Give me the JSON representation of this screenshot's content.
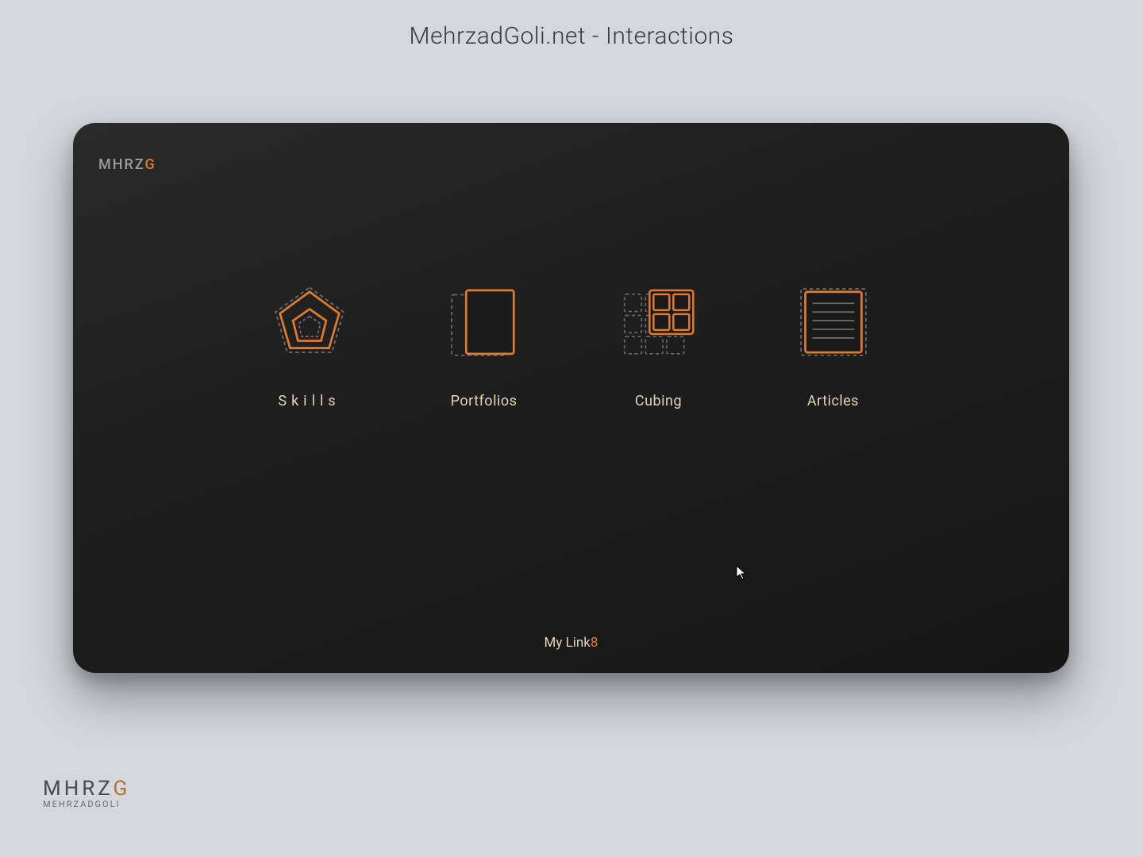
{
  "page": {
    "title": "MehrzadGoli.net - Interactions"
  },
  "logo": {
    "prefix": "MHRZ",
    "accent": "G"
  },
  "cards": [
    {
      "id": "skills",
      "label": "Skills",
      "icon": "pentagon-icon"
    },
    {
      "id": "portfolios",
      "label": "Portfolios",
      "icon": "stack-icon"
    },
    {
      "id": "cubing",
      "label": "Cubing",
      "icon": "grid-icon"
    },
    {
      "id": "articles",
      "label": "Articles",
      "icon": "document-icon"
    }
  ],
  "footer": {
    "link_prefix": "My Link",
    "link_accent": "8"
  },
  "brand": {
    "big_prefix": "MHRZ",
    "big_accent": "G",
    "small": "MEHRZADGOLI"
  },
  "colors": {
    "accent": "#e07a2e",
    "dashed": "#6a6a6a",
    "bg": "#1a1a1a"
  }
}
